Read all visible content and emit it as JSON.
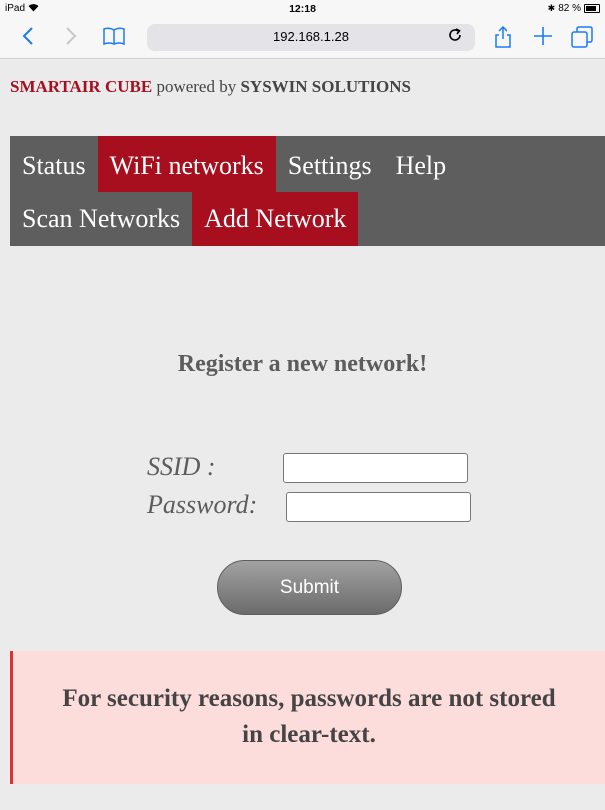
{
  "device": {
    "carrier": "iPad",
    "time": "12:18",
    "battery": "82 %"
  },
  "browser": {
    "url": "192.168.1.28"
  },
  "site": {
    "brand_primary": "SMARTAIR CUBE",
    "brand_connector": "powered by",
    "brand_secondary": "SYSWIN SOLUTIONS"
  },
  "nav": {
    "main_items": [
      {
        "label": "Status",
        "active": false
      },
      {
        "label": "WiFi networks",
        "active": true
      },
      {
        "label": "Settings",
        "active": false
      },
      {
        "label": "Help",
        "active": false
      }
    ],
    "sub_items": [
      {
        "label": "Scan Networks",
        "active": false
      },
      {
        "label": "Add Network",
        "active": true
      }
    ]
  },
  "form": {
    "heading": "Register a new network!",
    "ssid_label": "SSID :",
    "ssid_value": "",
    "password_label": "Password:",
    "password_value": "",
    "submit_label": "Submit"
  },
  "notice": {
    "text": "For security reasons, passwords are not stored in clear-text."
  },
  "colors": {
    "accent": "#a70f1e",
    "nav_background": "#5e5e5e",
    "page_background": "#ebebeb",
    "notice_background": "#fddcdc",
    "notice_border": "#e0302f"
  },
  "icons": {
    "back": "back-arrow-icon",
    "forward": "forward-arrow-icon",
    "bookmarks": "bookmarks-book-icon",
    "reload": "reload-icon",
    "share": "share-icon",
    "new_tab": "plus-icon",
    "tabs": "tabs-icon",
    "wifi": "wifi-icon",
    "bluetooth": "bluetooth-icon",
    "battery": "battery-icon"
  }
}
